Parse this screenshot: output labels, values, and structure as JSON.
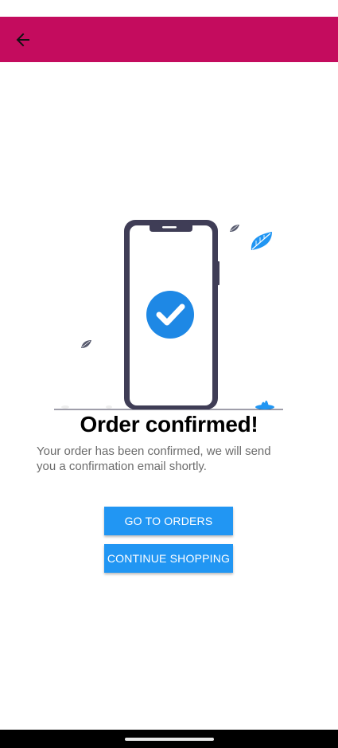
{
  "colors": {
    "app_bar": "#c40c5e",
    "button": "#2196f3",
    "phone_frame": "#3f3d56",
    "check_circle": "#1e88e5",
    "leaf_blue": "#2196f3",
    "leaf_gray": "#575a6e"
  },
  "app_bar": {
    "back_icon": "arrow-left-icon"
  },
  "confirmation": {
    "illustration_icon": "phone-check-illustration",
    "title": "Order confirmed!",
    "message": "Your order has been confirmed, we will send you a confirmation email shortly."
  },
  "actions": {
    "go_to_orders_label": "GO TO ORDERS",
    "continue_shopping_label": "CONTINUE SHOPPING"
  }
}
